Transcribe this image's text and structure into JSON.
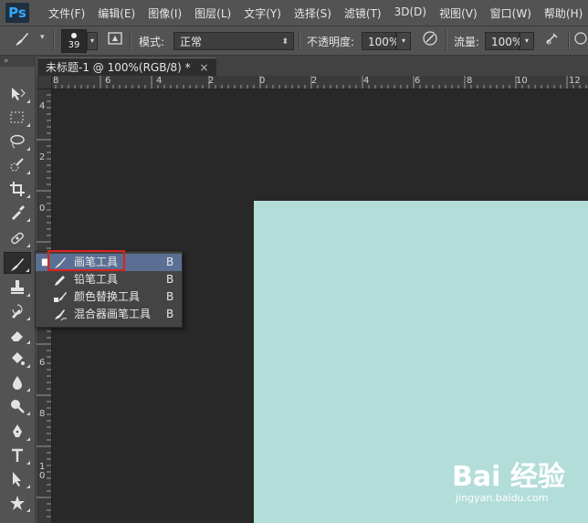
{
  "app": {
    "logo": "Ps"
  },
  "menubar": {
    "items": [
      "文件(F)",
      "编辑(E)",
      "图像(I)",
      "图层(L)",
      "文字(Y)",
      "选择(S)",
      "滤镜(T)",
      "3D(D)",
      "视图(V)",
      "窗口(W)",
      "帮助(H)"
    ]
  },
  "options": {
    "brush_size": "39",
    "mode_label": "模式:",
    "mode_value": "正常",
    "opacity_label": "不透明度:",
    "opacity_value": "100%",
    "flow_label": "流量:",
    "flow_value": "100%"
  },
  "document": {
    "tab_title": "未标题-1 @ 100%(RGB/8) *",
    "close_glyph": "×"
  },
  "toolbar": {
    "header": "»",
    "tools": [
      {
        "name": "move-tool",
        "icon": "move-icon"
      },
      {
        "name": "marquee-tool",
        "icon": "marquee-icon"
      },
      {
        "name": "lasso-tool",
        "icon": "lasso-icon"
      },
      {
        "name": "quick-select-tool",
        "icon": "quick-select-icon"
      },
      {
        "name": "crop-tool",
        "icon": "crop-icon"
      },
      {
        "name": "eyedropper-tool",
        "icon": "eyedropper-icon"
      },
      {
        "name": "healing-brush-tool",
        "icon": "bandage-icon"
      },
      {
        "name": "brush-tool",
        "icon": "brush-icon"
      },
      {
        "name": "clone-stamp-tool",
        "icon": "stamp-icon"
      },
      {
        "name": "history-brush-tool",
        "icon": "history-brush-icon"
      },
      {
        "name": "eraser-tool",
        "icon": "eraser-icon"
      },
      {
        "name": "paint-bucket-tool",
        "icon": "bucket-icon"
      },
      {
        "name": "blur-tool",
        "icon": "drop-icon"
      },
      {
        "name": "dodge-tool",
        "icon": "dodge-icon"
      },
      {
        "name": "pen-tool",
        "icon": "pen-icon"
      },
      {
        "name": "type-tool",
        "icon": "type-icon"
      },
      {
        "name": "path-select-tool",
        "icon": "arrow-icon"
      },
      {
        "name": "shape-tool",
        "icon": "shape-icon"
      }
    ]
  },
  "ruler": {
    "h_labels": [
      "8",
      "6",
      "4",
      "2",
      "0",
      "2",
      "4",
      "6",
      "8",
      "10",
      "12"
    ],
    "v_labels": [
      "4",
      "2",
      "0",
      "2",
      "4",
      "6",
      "8",
      "1 0"
    ]
  },
  "flyout": {
    "items": [
      {
        "label": "画笔工具",
        "key": "B",
        "icon": "brush-icon",
        "selected": true
      },
      {
        "label": "铅笔工具",
        "key": "B",
        "icon": "pencil-icon",
        "selected": false
      },
      {
        "label": "颜色替换工具",
        "key": "B",
        "icon": "color-replace-icon",
        "selected": false
      },
      {
        "label": "混合器画笔工具",
        "key": "B",
        "icon": "mixer-brush-icon",
        "selected": false
      }
    ],
    "bullet": "■"
  },
  "colors": {
    "canvas": "#b3ddd9",
    "workspace": "#282828",
    "highlight": "#e0201b",
    "selection": "#5a6f93"
  },
  "watermark": {
    "logo": "Bai 经验",
    "url": "jingyan.baidu.com"
  }
}
